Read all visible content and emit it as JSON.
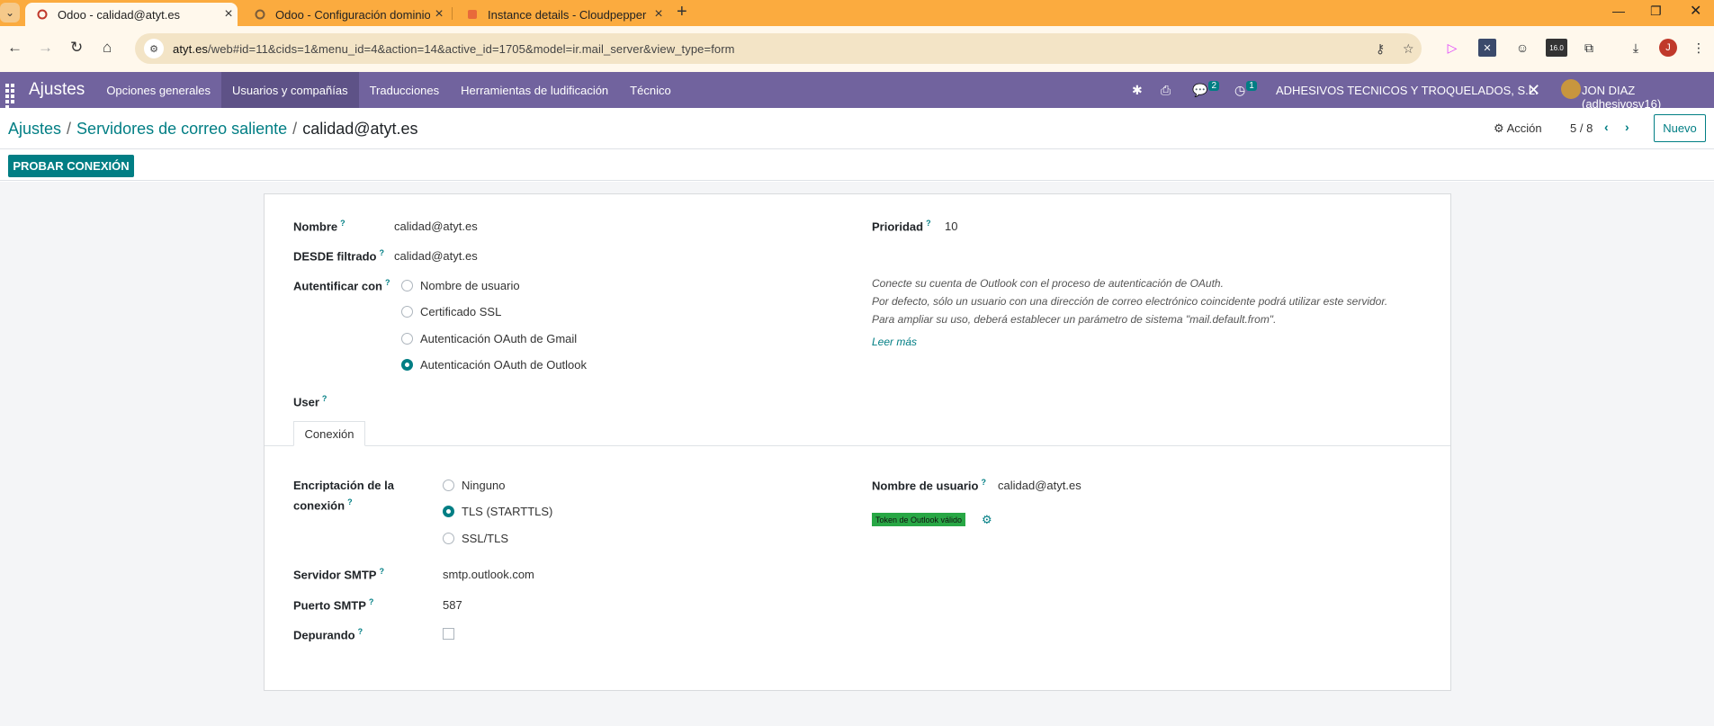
{
  "browser": {
    "tabs": [
      {
        "title": "Odoo - calidad@atyt.es",
        "active": true
      },
      {
        "title": "Odoo - Configuración dominio",
        "active": false
      },
      {
        "title": "Instance details - Cloudpepper",
        "active": false
      }
    ],
    "url_host": "atyt.es",
    "url_path": "/web#id=11&cids=1&menu_id=4&action=14&active_id=1705&model=ir.mail_server&view_type=form",
    "ext_badge": "16.0",
    "profile_initial": "J"
  },
  "navbar": {
    "brand": "Ajustes",
    "menu": [
      "Opciones generales",
      "Usuarios y compañías",
      "Traducciones",
      "Herramientas de ludificación",
      "Técnico"
    ],
    "messages_count": "2",
    "activities_count": "1",
    "company": "ADHESIVOS TECNICOS Y TROQUELADOS, S.L.",
    "user": "JON DIAZ (adhesivosv16)"
  },
  "breadcrumb": {
    "root": "Ajustes",
    "parent": "Servidores de correo saliente",
    "current": "calidad@atyt.es"
  },
  "control": {
    "action_label": "Acción",
    "pager": "5 / 8",
    "new_label": "Nuevo"
  },
  "statusbar": {
    "test_button": "PROBAR CONEXIÓN"
  },
  "form": {
    "name_label": "Nombre",
    "name_value": "calidad@atyt.es",
    "from_label": "DESDE filtrado",
    "from_value": "calidad@atyt.es",
    "auth_label": "Autentificar con",
    "auth_options": [
      "Nombre de usuario",
      "Certificado SSL",
      "Autenticación OAuth de Gmail",
      "Autenticación OAuth de Outlook"
    ],
    "auth_selected": "Autenticación OAuth de Outlook",
    "user_label": "User",
    "priority_label": "Prioridad",
    "priority_value": "10",
    "help_line1": "Conecte su cuenta de Outlook con el proceso de autenticación de OAuth.",
    "help_line2": "Por defecto, sólo un usuario con una dirección de correo electrónico coincidente podrá utilizar este servidor.",
    "help_line3": "Para ampliar su uso, deberá establecer un parámetro de sistema \"mail.default.from\".",
    "read_more": "Leer más",
    "tab_label": "Conexión",
    "enc_label_1": "Encriptación de la",
    "enc_label_2": "conexión",
    "enc_options": [
      "Ninguno",
      "TLS (STARTTLS)",
      "SSL/TLS"
    ],
    "enc_selected": "TLS (STARTTLS)",
    "smtp_label": "Servidor SMTP",
    "smtp_value": "smtp.outlook.com",
    "port_label": "Puerto SMTP",
    "port_value": "587",
    "debug_label": "Depurando",
    "debug_checked": false,
    "username_label": "Nombre de usuario",
    "username_value": "calidad@atyt.es",
    "token_badge": "Token de Outlook válido"
  },
  "colors": {
    "odoo_primary": "#71639e",
    "accent": "#017e84",
    "tabbar": "#fbab3f",
    "token_green": "#28a745"
  }
}
